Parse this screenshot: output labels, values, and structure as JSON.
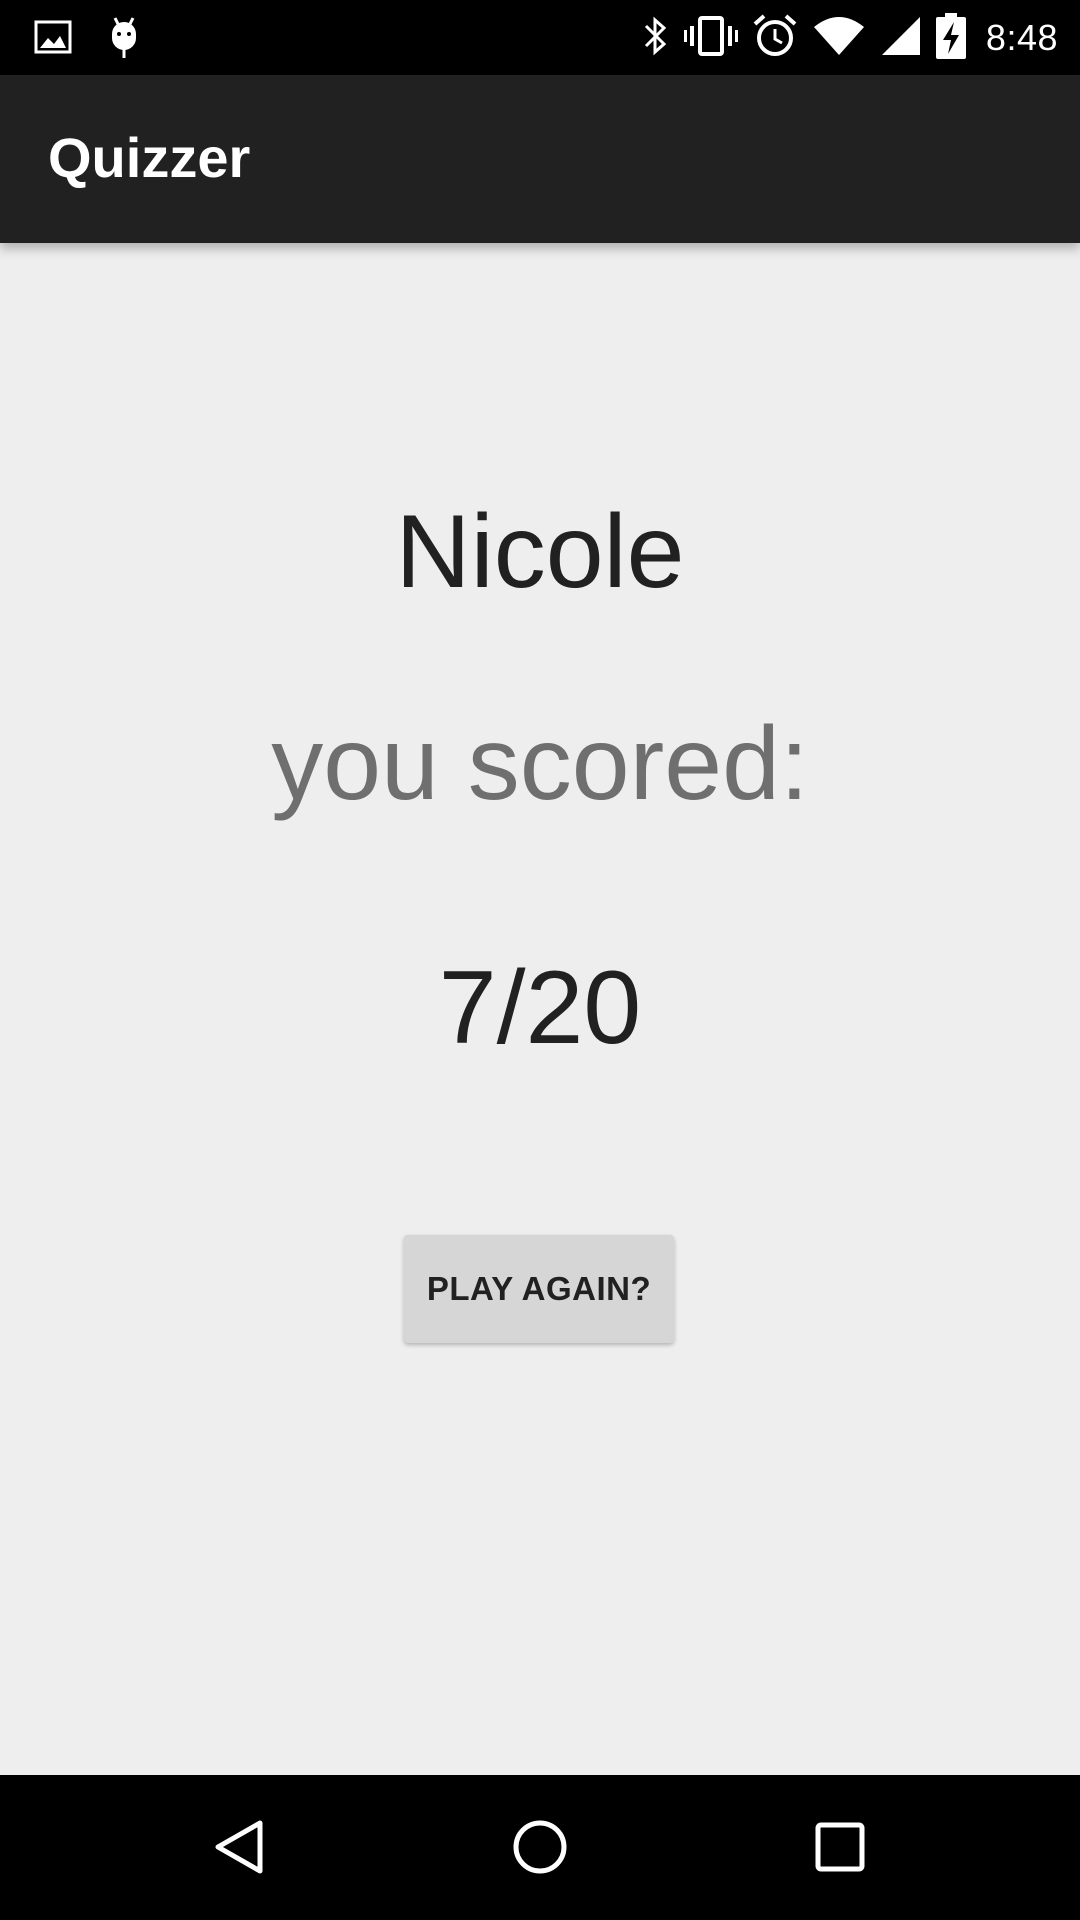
{
  "status_bar": {
    "time": "8:48",
    "left_icons": [
      "image-icon",
      "android-debug-icon"
    ],
    "right_icons": [
      "bluetooth-icon",
      "vibrate-icon",
      "alarm-icon",
      "wifi-icon",
      "signal-icon",
      "battery-charging-icon"
    ]
  },
  "app_bar": {
    "title": "Quizzer"
  },
  "result": {
    "player_name": "Nicole",
    "score_label": "you scored:",
    "score_value": "7/20"
  },
  "actions": {
    "play_again_label": "PLAY AGAIN?"
  },
  "nav_bar": {
    "buttons": [
      "back-icon",
      "home-icon",
      "recents-icon"
    ]
  },
  "colors": {
    "app_bar": "#212121",
    "background": "#eeeeee",
    "button": "#d6d6d6",
    "secondary_text": "#6f6f6f"
  }
}
